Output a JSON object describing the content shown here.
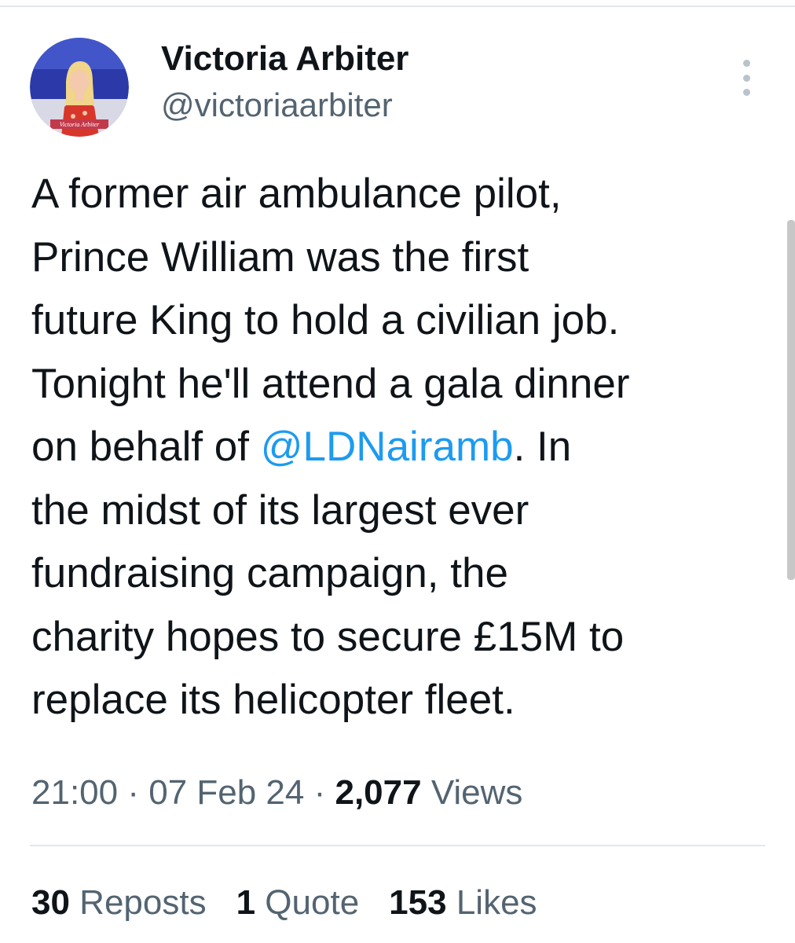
{
  "author": {
    "display_name": "Victoria Arbiter",
    "handle": "@victoriaarbiter",
    "avatar_caption": "Victoria Arbiter"
  },
  "tweet": {
    "lines": [
      "A former air ambulance pilot,",
      "Prince William was the first",
      "future King to hold a civilian job.",
      "Tonight he'll attend a gala dinner"
    ],
    "mention_line_before": "on behalf of ",
    "mention": "@LDNairamb",
    "mention_line_after": ". In",
    "lines_after": [
      "the midst of its largest ever",
      "fundraising campaign, the",
      "charity hopes to secure £15M to",
      "replace its helicopter fleet."
    ]
  },
  "meta": {
    "time": "21:00",
    "separator": " · ",
    "date": "07 Feb 24",
    "views_count": "2,077",
    "views_label": " Views"
  },
  "stats": {
    "reposts_count": "30",
    "reposts_label": " Reposts",
    "quotes_count": "1",
    "quotes_label": " Quote",
    "likes_count": "153",
    "likes_label": " Likes"
  },
  "icons": {
    "more": "more-vertical-icon"
  },
  "colors": {
    "text": "#0f1419",
    "secondary": "#536471",
    "link": "#1d9bf0",
    "divider": "#e3e7ea"
  }
}
